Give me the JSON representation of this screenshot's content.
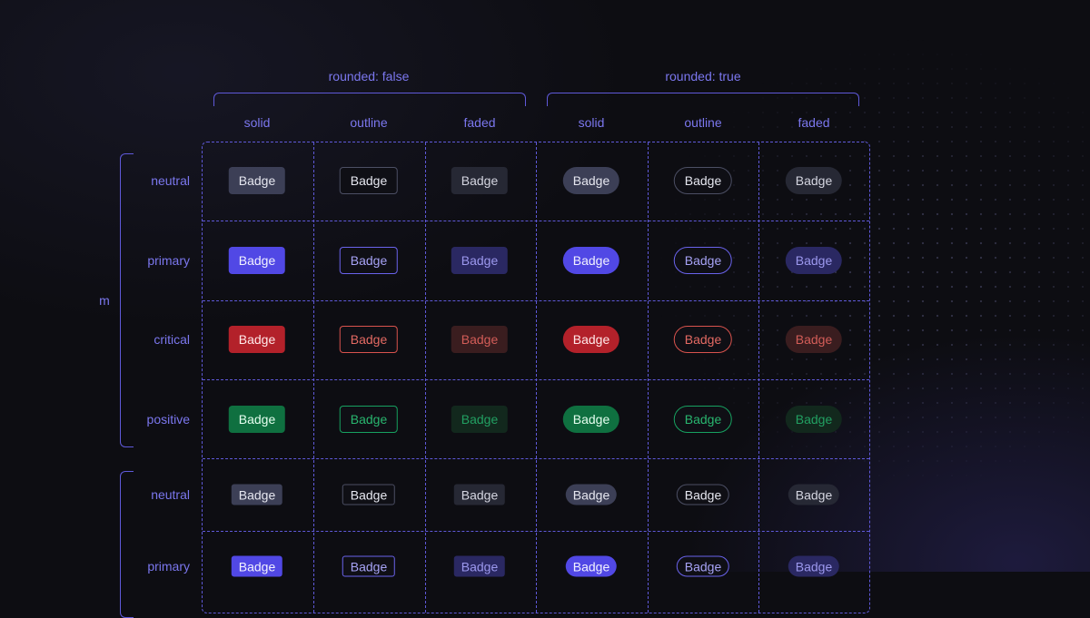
{
  "groups": [
    {
      "label": "rounded: false"
    },
    {
      "label": "rounded: true"
    }
  ],
  "columns": [
    {
      "label": "solid",
      "variant": "solid",
      "rounded": false
    },
    {
      "label": "outline",
      "variant": "outline",
      "rounded": false
    },
    {
      "label": "faded",
      "variant": "faded",
      "rounded": false
    },
    {
      "label": "solid",
      "variant": "solid",
      "rounded": true
    },
    {
      "label": "outline",
      "variant": "outline",
      "rounded": true
    },
    {
      "label": "faded",
      "variant": "faded",
      "rounded": true
    }
  ],
  "sizes": [
    {
      "label": "m",
      "size": "m"
    },
    {
      "label": "",
      "size": "s"
    }
  ],
  "rows": [
    {
      "label": "neutral",
      "color": "neutral",
      "size": "m"
    },
    {
      "label": "primary",
      "color": "primary",
      "size": "m"
    },
    {
      "label": "critical",
      "color": "critical",
      "size": "m"
    },
    {
      "label": "positive",
      "color": "positive",
      "size": "m"
    },
    {
      "label": "neutral",
      "color": "neutral",
      "size": "s"
    },
    {
      "label": "primary",
      "color": "primary",
      "size": "s"
    }
  ],
  "badge_text": "Badge",
  "colors": {
    "background": "#0d0d12",
    "accent": "#5f59d9",
    "label": "#7b77ee",
    "neutral": "#3c3f56",
    "primary": "#5148e5",
    "critical": "#b3212a",
    "positive": "#0f7040"
  }
}
